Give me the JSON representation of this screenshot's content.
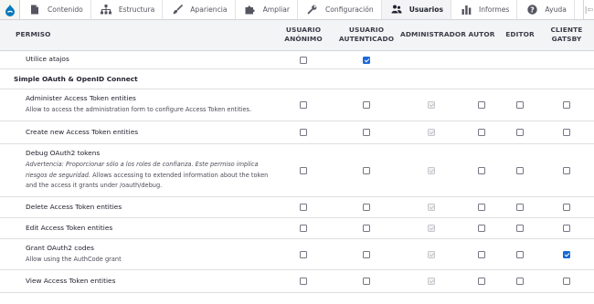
{
  "toolbar": {
    "items": [
      {
        "label": "Contenido",
        "icon": "file-icon"
      },
      {
        "label": "Estructura",
        "icon": "sitemap-icon"
      },
      {
        "label": "Apariencia",
        "icon": "paintbrush-icon"
      },
      {
        "label": "Ampliar",
        "icon": "puzzle-icon"
      },
      {
        "label": "Configuración",
        "icon": "wrench-icon"
      },
      {
        "label": "Usuarios",
        "icon": "people-icon"
      },
      {
        "label": "Informes",
        "icon": "bar-chart-icon"
      },
      {
        "label": "Ayuda",
        "icon": "help-icon"
      }
    ],
    "active": "Usuarios",
    "end_glyph": "|⇦"
  },
  "table": {
    "headers": {
      "permission": "PERMISO",
      "anon": "USUARIO ANÓNIMO",
      "auth": "USUARIO AUTENTICADO",
      "admin": "ADMINISTRADOR",
      "author": "AUTOR",
      "editor": "EDITOR",
      "gatsby": "CLIENTE GATSBY"
    },
    "top_row": {
      "title": "Utilice atajos",
      "checks": {
        "anon": false,
        "auth": true,
        "admin": null,
        "author": null,
        "editor": null,
        "gatsby": null
      }
    },
    "module": "Simple OAuth & OpenID Connect",
    "rows": [
      {
        "title": "Administer Access Token entities",
        "desc": "Allow to access the administration form to configure Access Token entities.",
        "checks": {
          "anon": false,
          "auth": false,
          "admin": true,
          "author": false,
          "editor": false,
          "gatsby": false
        }
      },
      {
        "title": "Create new Access Token entities",
        "checks": {
          "anon": false,
          "auth": false,
          "admin": true,
          "author": false,
          "editor": false,
          "gatsby": false
        }
      },
      {
        "title": "Debug OAuth2 tokens",
        "warning": "Advertencia: Proporcionar sólo a los roles de confianza. Este permiso implica riesgos de seguridad.",
        "desc": "Allows accessing to extended information about the token and the access it grants under /oauth/debug.",
        "checks": {
          "anon": false,
          "auth": false,
          "admin": true,
          "author": false,
          "editor": false,
          "gatsby": false
        }
      },
      {
        "title": "Delete Access Token entities",
        "checks": {
          "anon": false,
          "auth": false,
          "admin": true,
          "author": false,
          "editor": false,
          "gatsby": false
        }
      },
      {
        "title": "Edit Access Token entities",
        "checks": {
          "anon": false,
          "auth": false,
          "admin": true,
          "author": false,
          "editor": false,
          "gatsby": false
        }
      },
      {
        "title": "Grant OAuth2 codes",
        "desc": "Allow using the AuthCode grant",
        "checks": {
          "anon": false,
          "auth": false,
          "admin": true,
          "author": false,
          "editor": false,
          "gatsby": true
        }
      },
      {
        "title": "View Access Token entities",
        "checks": {
          "anon": false,
          "auth": false,
          "admin": true,
          "author": false,
          "editor": false,
          "gatsby": false
        }
      }
    ]
  },
  "colors": {
    "accent": "#1a68d6",
    "header_bg": "#f3f4f6",
    "border": "#dedfe3"
  }
}
